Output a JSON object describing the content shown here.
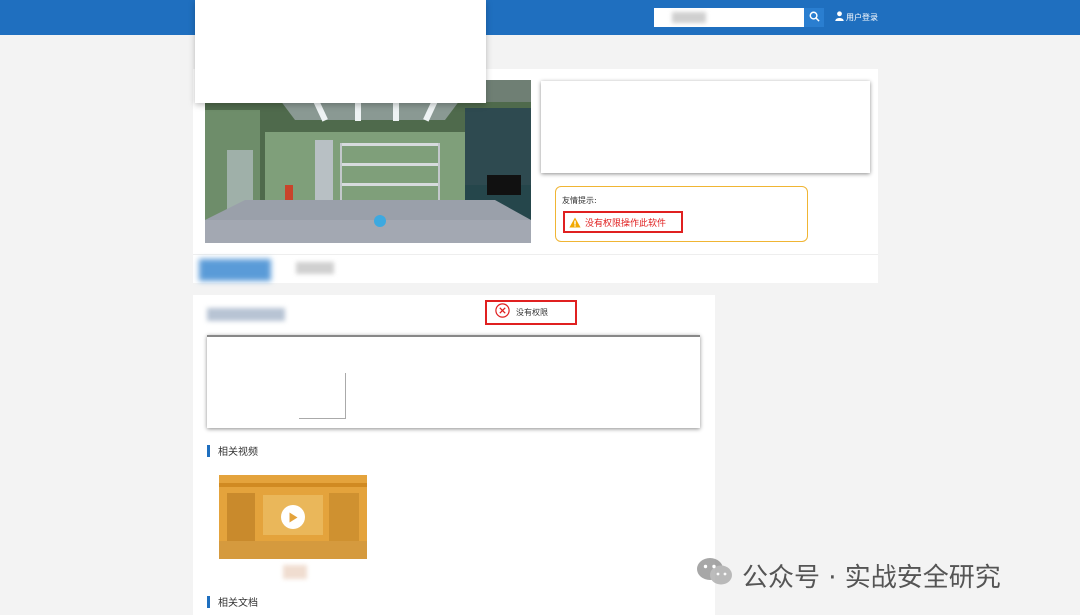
{
  "header": {
    "search_placeholder": "",
    "login_label": "用户登录"
  },
  "tip": {
    "title": "友情提示:",
    "warning": "没有权限操作此软件"
  },
  "permission": {
    "label": "没有权限"
  },
  "sections": {
    "related_videos": "相关视频",
    "related_docs": "相关文档"
  },
  "watermark": {
    "text": "公众号 · 实战安全研究"
  },
  "icons": [
    "search-icon",
    "user-icon",
    "warning-icon",
    "close-circle-icon",
    "play-icon",
    "wechat-icon"
  ],
  "colors": {
    "header": "#1f6fbf",
    "warning_border": "#f0b534",
    "error_red": "#e02020",
    "video_thumb": "#e4a33c"
  }
}
